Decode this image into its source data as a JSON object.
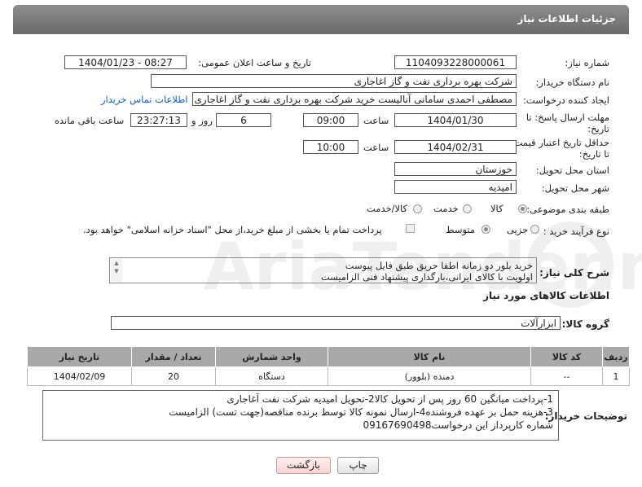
{
  "header": {
    "title": "جزئیات اطلاعات نیاز"
  },
  "fields": {
    "need_number_label": "شماره نیاز:",
    "need_number": "1104093228000061",
    "announce_label": "تاریخ و ساعت اعلان عمومی:",
    "announce_value": "1404/01/23 - 08:27",
    "buyer_label": "نام دستگاه خریدار:",
    "buyer_value": "شرکت بهره برداری نفت و گاز اغاجاری",
    "creator_label": "ایجاد کننده درخواست:",
    "creator_value": "مصطفی احمدی سامانی آنالیست خرید شرکت بهره برداری نفت و گاز اغاجاری",
    "contact_link": "اطلاعات تماس خریدار",
    "deadline_label_1": "مهلت ارسال پاسخ: تا",
    "deadline_label_2": "تاریخ:",
    "deadline_date": "1404/01/30",
    "time_label": "ساعت",
    "deadline_time": "09:00",
    "days_value": "6",
    "days_label": "روز و",
    "remaining_value": "23:27:13",
    "remaining_label": "ساعت باقی مانده",
    "validity_label_1": "حداقل تاریخ اعتبار قیمت:",
    "validity_label_2": "تا تاریخ:",
    "validity_date": "1404/02/31",
    "validity_time": "10:00",
    "province_label": "استان محل تحویل:",
    "province_value": "خوزستان",
    "city_label": "شهر محل تحویل:",
    "city_value": "امیدیه",
    "category_label": "طبقه بندی موضوعی:",
    "category_options": [
      "کالا",
      "خدمت",
      "کالا/خدمت"
    ],
    "process_label": "نوع فرآیند خرید :",
    "process_options": [
      "جزیی",
      "متوسط"
    ],
    "payment_note": "پرداخت تمام یا بخشی از مبلغ خرید،از محل \"اسناد خزانه اسلامی\" خواهد بود."
  },
  "description": {
    "label": "شرح کلی نیاز:",
    "line1": "خرید بلور دو زمانه اطفا حریق طبق فایل پیوست",
    "line2": "اولویت با کالای ایرانی،بارگذاری پیشنهاد فنی الزامیست"
  },
  "goods_section": {
    "title": "اطلاعات کالاهای مورد نیاز",
    "group_label": "گروه کالا:",
    "group_value": "ابزارآلات"
  },
  "table": {
    "headers": [
      "ردیف",
      "کد کالا",
      "نام کالا",
      "واحد شمارش",
      "تعداد / مقدار",
      "تاریخ نیاز"
    ],
    "rows": [
      [
        "1",
        "--",
        "دمنده (بلوور)",
        "دستگاه",
        "20",
        "1404/02/09"
      ]
    ]
  },
  "buyer_notes": {
    "label": "توضیحات خریدار:",
    "line1": "1-پرداخت میانگین 60 روز پس از تحویل کالا2-تحویل امیدیه شرکت نفت آغاجاری",
    "line2": "3-هزینه حمل بر عهده فروشنده4-ارسال نمونه کالا توسط برنده مناقصه(جهت تست) الزامیست",
    "line3": "شماره کارپرداز این درخواست09167690498"
  },
  "buttons": {
    "print": "چاپ",
    "back": "بازگشت"
  },
  "watermark": "AriaTender.neT"
}
